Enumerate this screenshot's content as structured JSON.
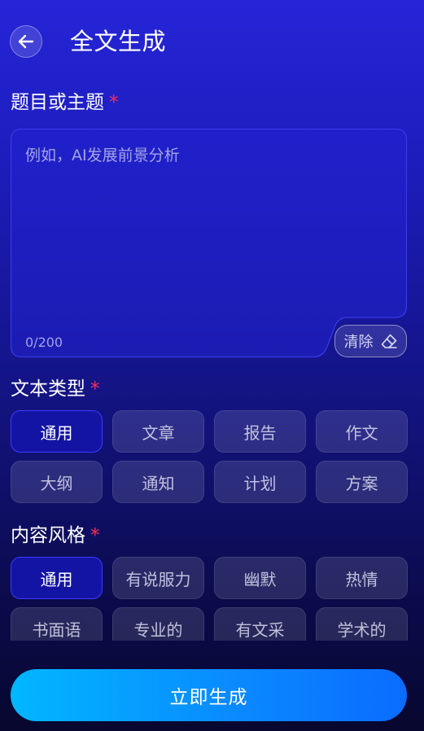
{
  "header": {
    "title": "全文生成",
    "back_icon": "arrow-left-icon"
  },
  "topic": {
    "label": "题目或主题",
    "required_mark": "*",
    "placeholder": "例如，AI发展前景分析",
    "value": "",
    "counter": "0/200",
    "clear_label": "清除",
    "clear_icon": "eraser-icon"
  },
  "text_type": {
    "label": "文本类型",
    "required_mark": "*",
    "selected": "通用",
    "options": [
      "通用",
      "文章",
      "报告",
      "作文",
      "大纲",
      "通知",
      "计划",
      "方案"
    ]
  },
  "content_style": {
    "label": "内容风格",
    "required_mark": "*",
    "selected": "通用",
    "options": [
      "通用",
      "有说服力",
      "幽默",
      "热情",
      "书面语",
      "专业的",
      "有文采",
      "学术的"
    ]
  },
  "generate_button": {
    "label": "立即生成"
  },
  "colors": {
    "accent": "#0a8bff",
    "required": "#ff2b5a",
    "selected_chip": "#1414a4"
  }
}
